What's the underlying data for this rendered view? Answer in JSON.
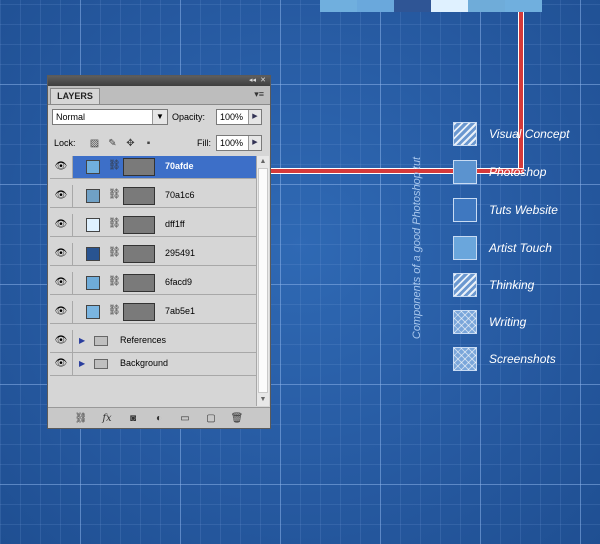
{
  "swatch_strip": [
    "#70afde",
    "#6aa8dc",
    "#2f5595",
    "#dff1ff",
    "#6facd9",
    "#70afde"
  ],
  "caption": "Components of a good Photoshop tut",
  "legend": [
    {
      "label": "Visual Concept",
      "pattern": "hatch",
      "color": "#6b98d0"
    },
    {
      "label": "Photoshop",
      "pattern": "solid",
      "color": "#5b93cf"
    },
    {
      "label": "Tuts Website",
      "pattern": "solid",
      "color": "#3f78c0"
    },
    {
      "label": "Artist Touch",
      "pattern": "solid",
      "color": "#6aa6dc"
    },
    {
      "label": "Thinking",
      "pattern": "hatch",
      "color": "#6b98d0"
    },
    {
      "label": "Writing",
      "pattern": "cross",
      "color": "#7aa6da"
    },
    {
      "label": "Screenshots",
      "pattern": "cross",
      "color": "#5d8fcf"
    }
  ],
  "panel": {
    "tab": "LAYERS",
    "blend_mode": "Normal",
    "opacity_label": "Opacity:",
    "opacity_value": "100%",
    "lock_label": "Lock:",
    "fill_label": "Fill:",
    "fill_value": "100%",
    "layers": [
      {
        "name": "70afde",
        "swatch": "#70afde",
        "selected": true
      },
      {
        "name": "70a1c6",
        "swatch": "#70a1c6",
        "selected": false
      },
      {
        "name": "dff1ff",
        "swatch": "#dff1ff",
        "selected": false
      },
      {
        "name": "295491",
        "swatch": "#295491",
        "selected": false
      },
      {
        "name": "6facd9",
        "swatch": "#6facd9",
        "selected": false
      },
      {
        "name": "7ab5e1",
        "swatch": "#7ab5e1",
        "selected": false
      }
    ],
    "groups": [
      {
        "name": "References"
      },
      {
        "name": "Background"
      }
    ]
  }
}
